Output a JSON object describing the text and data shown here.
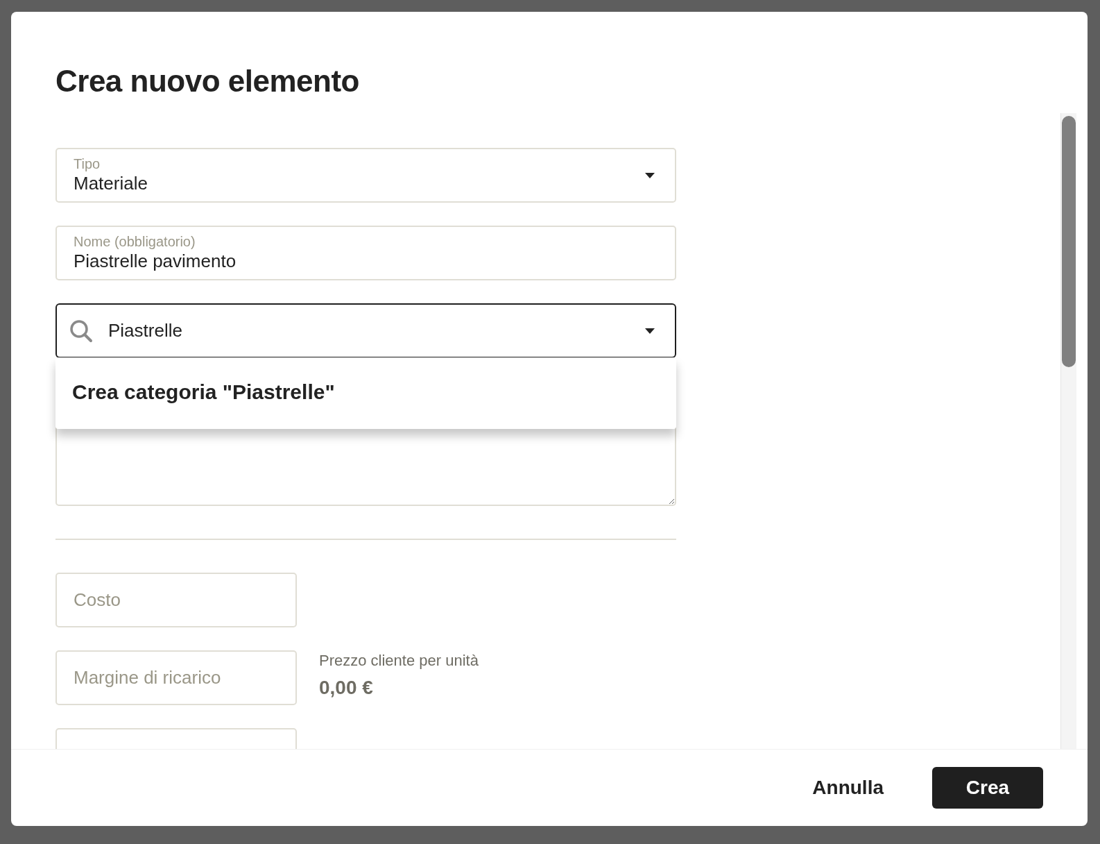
{
  "dialog": {
    "title": "Crea nuovo elemento"
  },
  "fields": [
    {
      "kind": "select",
      "label": "Tipo",
      "value": "Materiale"
    },
    {
      "kind": "text",
      "label": "Nome (obbligatorio)",
      "value": "Piastrelle pavimento"
    },
    {
      "kind": "search",
      "value": "Piastrelle",
      "expanded": true,
      "options": [
        {
          "label": "Crea categoria \"Piastrelle\""
        }
      ]
    },
    {
      "kind": "textarea"
    }
  ],
  "price_fields": [
    {
      "kind": "input",
      "placeholder": "Costo"
    },
    {
      "kind": "input",
      "placeholder": "Margine di ricarico"
    },
    {
      "kind": "input"
    }
  ],
  "customer_price": {
    "label": "Prezzo cliente per unità",
    "value": "0,00 €"
  },
  "buttons": [
    {
      "kind": "text",
      "label": "Annulla"
    },
    {
      "kind": "primary",
      "label": "Crea"
    }
  ]
}
